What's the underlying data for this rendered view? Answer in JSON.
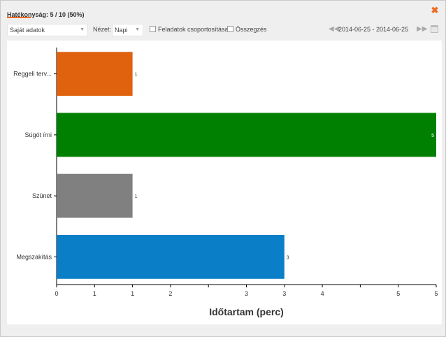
{
  "header": {
    "title": "Hatékonyság: 5 / 10 (50%)"
  },
  "toolbar": {
    "data_select": "Saját adatok",
    "view_label": "Nézet:",
    "view_select": "Napi",
    "group_tasks_label": "Feladatok csoportosítása",
    "summary_label": "Összegzés",
    "date_range": "2014-06-25 - 2014-06-25"
  },
  "colors": {
    "accent": "#ee6a22"
  },
  "icons": [
    "close-icon",
    "chevron-down-icon",
    "prev-arrow-icon",
    "next-arrow-icon",
    "calendar-icon"
  ],
  "chart_data": {
    "type": "bar",
    "orientation": "horizontal",
    "categories": [
      "Reggeli terv...",
      "Súgót írni",
      "Szünet",
      "Megszakítás"
    ],
    "values": [
      1,
      5,
      1,
      3
    ],
    "colors": [
      "#e0620f",
      "#008000",
      "#808080",
      "#0b7ec8"
    ],
    "data_labels": [
      "1",
      "5",
      "1",
      "3"
    ],
    "xlabel": "Időtartam (perc)",
    "xlim": [
      0,
      5
    ],
    "x_ticks": [
      "0",
      "1",
      "1",
      "2",
      "3",
      "3",
      "4",
      "5",
      "5"
    ],
    "x_tick_values": [
      0,
      0.5,
      1,
      1.5,
      2,
      2.5,
      3,
      3.5,
      4,
      4.5,
      5
    ]
  }
}
